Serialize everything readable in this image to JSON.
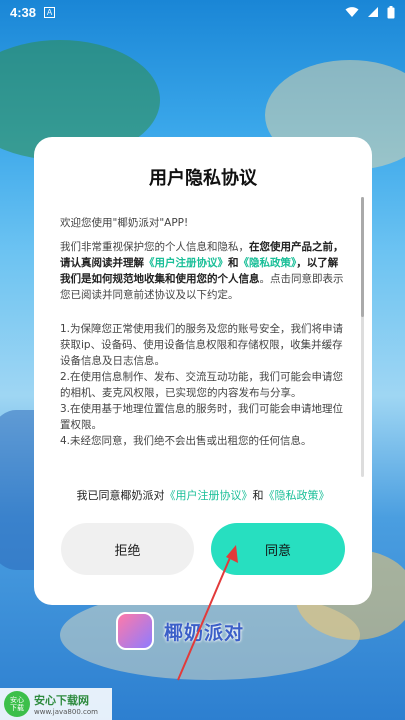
{
  "status": {
    "time": "4:38",
    "notification_label": "A"
  },
  "dialog": {
    "title": "用户隐私协议",
    "welcome": "欢迎您使用\"椰奶派对\"APP!",
    "para1_a": "我们非常重视保护您的个人信息和隐私，",
    "para1_b": "在您使用产品之前，请认真阅读并理解",
    "para1_link1": "《用户注册协议》",
    "para1_and": "和",
    "para1_link2": "《隐私政策》",
    "para1_c": "，以了解我们是如何规范地收集和使用您的个人信息",
    "para1_d": "。点击同意即表示您已阅读并同意前述协议及以下约定。",
    "item1": "1.为保障您正常使用我们的服务及您的账号安全，我们将申请获取ip、设备码、使用设备信息权限和存储权限，收集并缓存设备信息及日志信息。",
    "item2": "2.在使用信息制作、发布、交流互动功能，我们可能会申请您的相机、麦克风权限，已实现您的内容发布与分享。",
    "item3": "3.在使用基于地理位置信息的服务时，我们可能会申请地理位置权限。",
    "item4": "4.未经您同意，我们绝不会出售或出租您的任何信息。",
    "agree_prefix": "我已同意椰奶派对",
    "agree_link1": "《用户注册协议》",
    "agree_and": "和",
    "agree_link2": "《隐私政策》",
    "decline_label": "拒绝",
    "agree_label": "同意"
  },
  "app": {
    "name": "椰奶派对"
  },
  "watermark": {
    "icon_text": "安心\n下载",
    "title": "安心下载网",
    "url": "www.java800.com"
  },
  "colors": {
    "accent": "#27dfc0",
    "link": "#1abf98",
    "arrow": "#e23a3a"
  }
}
